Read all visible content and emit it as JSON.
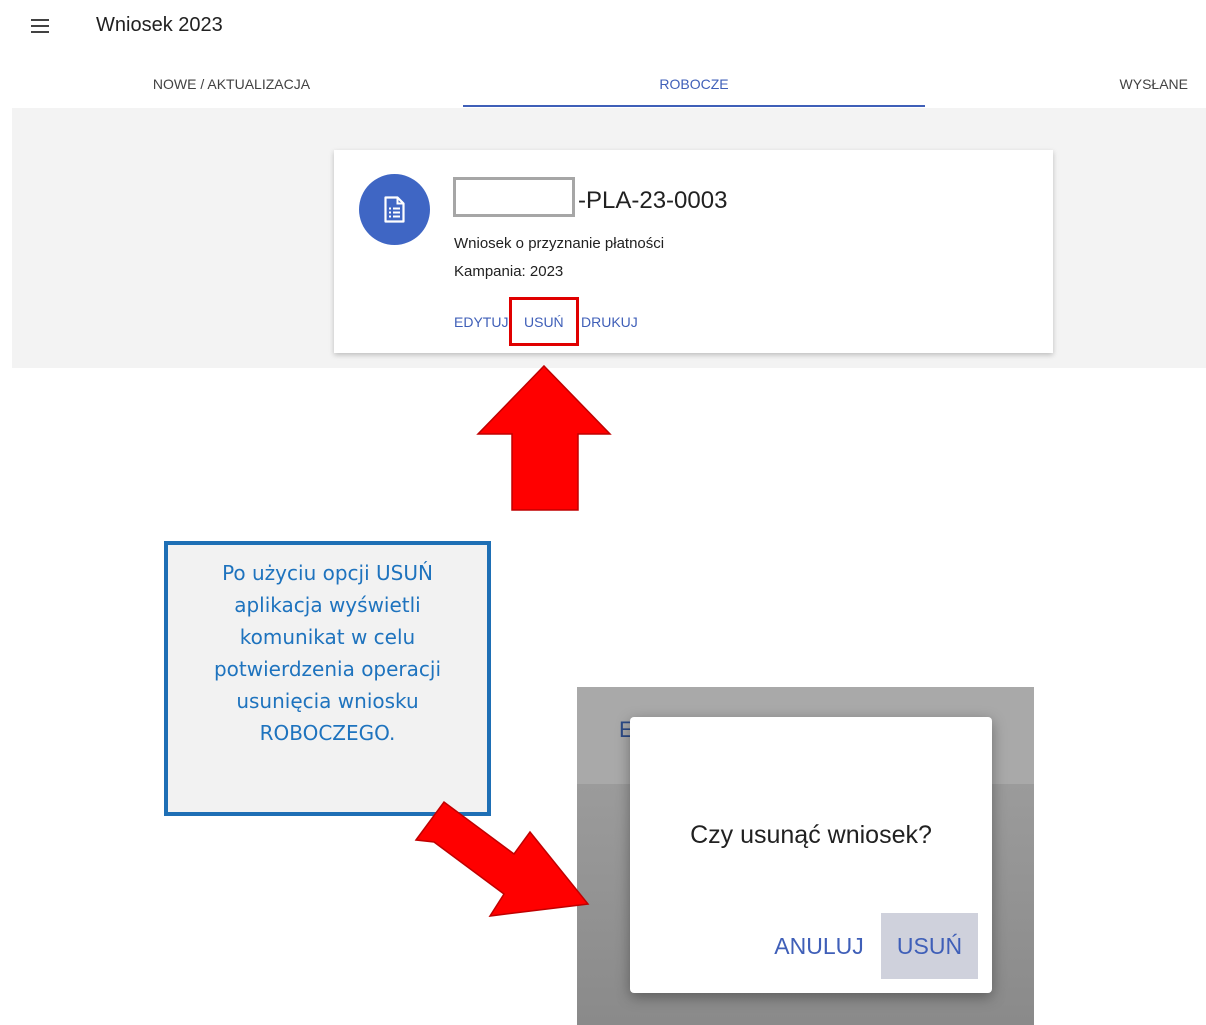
{
  "app_bar": {
    "title": "Wniosek 2023",
    "menu_icon": "hamburger-menu-icon"
  },
  "tabs": [
    {
      "label": "NOWE / AKTUALIZACJA",
      "active": false
    },
    {
      "label": "ROBOCZE",
      "active": true
    },
    {
      "label": "WYSŁANE",
      "active": false
    }
  ],
  "card": {
    "icon": "document-list-icon",
    "number_suffix": "-PLA-23-0003",
    "type": "Wniosek o przyznanie płatności",
    "campaign": "Kampania: 2023",
    "actions": {
      "edit": "EDYTUJ",
      "delete": "USUŃ",
      "print": "DRUKUJ"
    }
  },
  "callout": {
    "lines": [
      "Po użyciu opcji USUŃ",
      "aplikacja wyświetli",
      "komunikat w celu",
      "potwierdzenia operacji",
      "usunięcia wniosku",
      "ROBOCZEGO."
    ]
  },
  "dialog": {
    "background_fragment": "E",
    "question": "Czy usunąć wniosek?",
    "cancel_label": "ANULUJ",
    "confirm_label": "USUŃ"
  },
  "colors": {
    "accent": "#3f5fb8",
    "avatar": "#3f66c4",
    "highlight": "#e00000",
    "arrow": "#ff0000",
    "callout_border": "#1e6fb5",
    "callout_text": "#1e73be"
  }
}
